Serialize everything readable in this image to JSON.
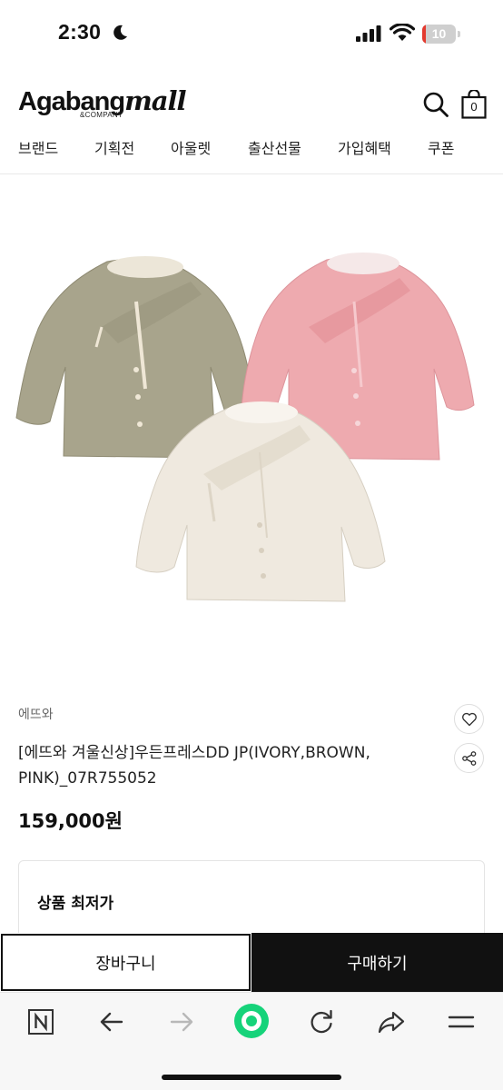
{
  "status_bar": {
    "time": "2:30",
    "battery_percent": "10",
    "battery_level": 0.1
  },
  "header": {
    "logo_main": "Agabang",
    "logo_accent": "mall",
    "logo_sub": "&COMPANY",
    "cart_count": "0"
  },
  "nav": {
    "items": [
      "브랜드",
      "기획전",
      "아울렛",
      "출산선물",
      "가입혜택",
      "쿠폰"
    ]
  },
  "product": {
    "brand": "에뜨와",
    "title": "[에뜨와 겨울신상]우든프레스DD JP(IVORY,BROWN, PINK)_07R755052",
    "price": "159,000원",
    "colors": {
      "brown": "#a8a48c",
      "pink": "#eeaaaf",
      "ivory": "#efe9df"
    }
  },
  "lowest_price_section": {
    "label": "상품 최저가"
  },
  "actions": {
    "cart_label": "장바구니",
    "buy_label": "구매하기"
  },
  "browser_toolbar": {
    "icons": [
      "naver-n-icon",
      "back-arrow-icon",
      "forward-arrow-icon",
      "home-circle-icon",
      "reload-icon",
      "share-icon",
      "menu-icon"
    ]
  }
}
